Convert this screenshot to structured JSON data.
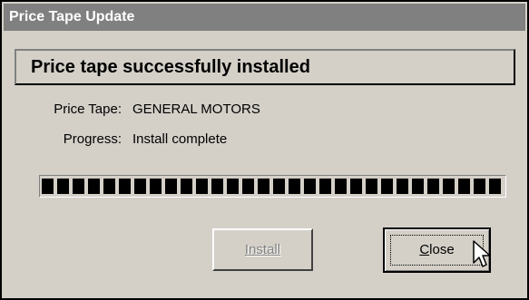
{
  "window": {
    "title": "Price Tape Update"
  },
  "message": "Price tape successfully installed",
  "fields": {
    "price_tape_label": "Price Tape:",
    "price_tape_value": "GENERAL MOTORS",
    "progress_label": "Progress:",
    "progress_value": "Install complete"
  },
  "progress_bar": {
    "fraction": 1.0
  },
  "buttons": {
    "install_label": "Install",
    "install_enabled": false,
    "close_label": "Close",
    "close_focused": true
  },
  "cursor": {
    "icon": "arrow-pointer-icon"
  },
  "colors": {
    "face": "#d4d0c8",
    "title_bar": "#808080",
    "progress_block": "#000000",
    "disabled_text": "#808080"
  }
}
